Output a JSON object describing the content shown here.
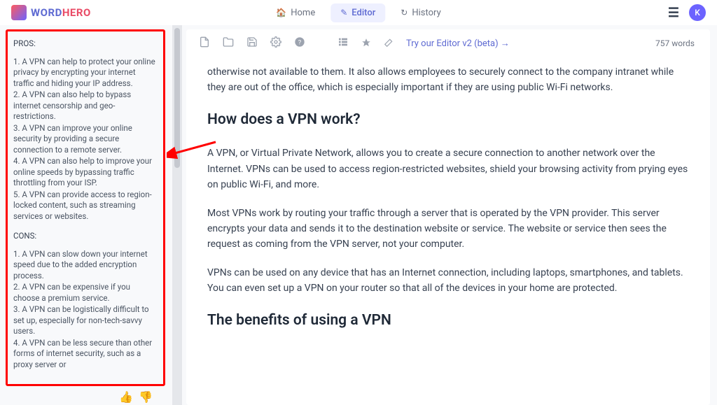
{
  "header": {
    "logo_word": "WORD",
    "logo_hero": "HERO",
    "nav": {
      "home": "Home",
      "editor": "Editor",
      "history": "History"
    },
    "avatar_initial": "K"
  },
  "sidebar": {
    "pros_label": "PROS:",
    "pros": [
      "1. A VPN can help to protect your online privacy by encrypting your internet traffic and hiding your IP address.",
      "2. A VPN can also help to bypass internet censorship and geo-restrictions.",
      "3. A VPN can improve your online security by providing a secure connection to a remote server.",
      "4. A VPN can also help to improve your online speeds by bypassing traffic throttling from your ISP.",
      "5. A VPN can provide access to region-locked content, such as streaming services or websites."
    ],
    "cons_label": "CONS:",
    "cons": [
      "1. A VPN can slow down your internet speed due to the added encryption process.",
      "2. A VPN can be expensive if you choose a premium service.",
      "3. A VPN can be logistically difficult to set up, especially for non-tech-savvy users.",
      "4. A VPN can be less secure than other forms of internet security, such as a proxy server or"
    ]
  },
  "toolbar": {
    "try_editor": "Try our Editor v2 (beta) →",
    "word_count": "757 words"
  },
  "article": {
    "intro_fragment": "otherwise not available to them. It also allows employees to securely connect to the company intranet while they are out of the office, which is especially important if they are using public Wi-Fi networks.",
    "h2_how": "How does a VPN work?",
    "p_how_1": "A VPN, or Virtual Private Network, allows you to create a secure connection to another network over the Internet. VPNs can be used to access region-restricted websites, shield your browsing activity from prying eyes on public Wi-Fi, and more.",
    "p_how_2": "Most VPNs work by routing your traffic through a server that is operated by the VPN provider. This server encrypts your data and sends it to the destination website or service. The website or service then sees the request as coming from the VPN server, not your computer.",
    "p_how_3": "VPNs can be used on any device that has an Internet connection, including laptops, smartphones, and tablets. You can even set up a VPN on your router so that all of the devices in your home are protected.",
    "h2_benefits": "The benefits of using a VPN"
  }
}
